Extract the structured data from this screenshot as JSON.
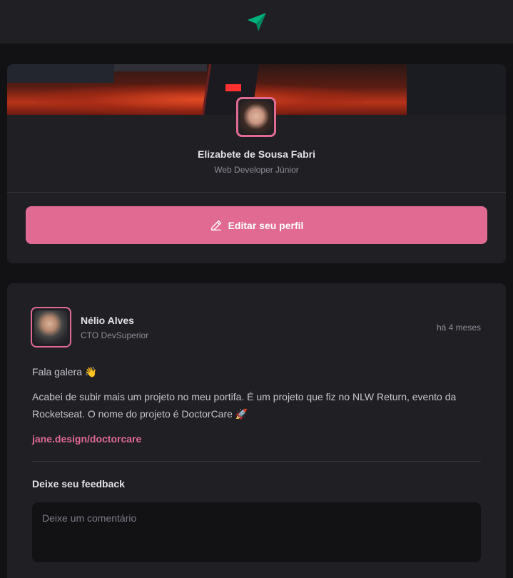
{
  "header": {
    "logo_icon": "ignite-logo-icon"
  },
  "profile": {
    "name": "Elizabete de Sousa Fabri",
    "role": "Web Developer Júnior",
    "edit_button_label": "Editar seu perfil",
    "edit_icon": "pencil-icon"
  },
  "post": {
    "author": {
      "name": "Nélio Alves",
      "role": "CTO DevSuperior"
    },
    "time": "há 4 meses",
    "content": {
      "greeting": "Fala galera 👋",
      "body": "Acabei de subir mais um projeto no meu portifa. É um projeto que fiz no NLW Return, evento da Rocketseat. O nome do projeto é DoctorCare 🚀",
      "link": "jane.design/doctorcare"
    },
    "feedback": {
      "title": "Deixe seu feedback",
      "placeholder": "Deixe um comentário"
    }
  },
  "colors": {
    "accent": "#e16a93",
    "background": "#121214",
    "card": "#202024",
    "brand_green": "#00875f"
  }
}
